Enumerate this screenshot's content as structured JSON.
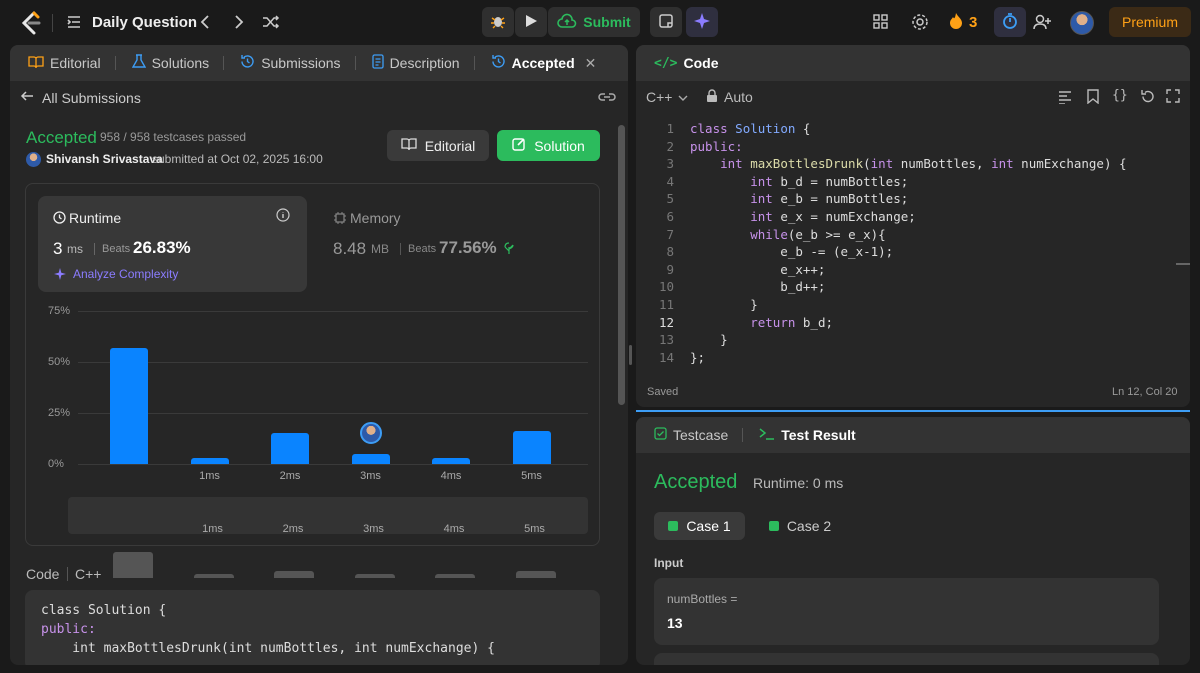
{
  "topbar": {
    "title": "Daily Question",
    "submit": "Submit",
    "streak": "3",
    "premium": "Premium"
  },
  "left_tabs": [
    "Editorial",
    "Solutions",
    "Submissions",
    "Description",
    "Accepted"
  ],
  "all_submissions": "All Submissions",
  "result": {
    "status": "Accepted",
    "passed": "958 / 958 testcases passed",
    "user": "Shivansh Srivastava",
    "submitted": "submitted at Oct 02, 2025 16:00",
    "editorial_btn": "Editorial",
    "solution_btn": "Solution"
  },
  "runtime": {
    "label": "Runtime",
    "value": "3",
    "unit": "ms",
    "beats_label": "Beats",
    "beats": "26.83%",
    "analyze": "Analyze Complexity"
  },
  "memory": {
    "label": "Memory",
    "value": "8.48",
    "unit": "MB",
    "beats_label": "Beats",
    "beats": "77.56%"
  },
  "chart_data": {
    "type": "bar",
    "categories": [
      "",
      "1ms",
      "2ms",
      "3ms",
      "4ms",
      "5ms"
    ],
    "values": [
      57,
      3,
      15,
      5,
      3,
      16
    ],
    "yticks": [
      "75%",
      "50%",
      "25%",
      "0%"
    ],
    "ylim": [
      0,
      75
    ],
    "highlight": "3ms",
    "minimap_labels": [
      "1ms",
      "2ms",
      "3ms",
      "4ms",
      "5ms"
    ]
  },
  "code_section": {
    "label": "Code",
    "lang": "C++",
    "lines": [
      "class Solution {",
      "public:",
      "    int maxBottlesDrunk(int numBottles, int numExchange) {"
    ]
  },
  "editor": {
    "title": "Code",
    "lang": "C++",
    "mode": "Auto",
    "saved": "Saved",
    "cursor": "Ln 12, Col 20",
    "lines": [
      "class Solution {",
      "public:",
      "    int maxBottlesDrunk(int numBottles, int numExchange) {",
      "        int b_d = numBottles;",
      "        int e_b = numBottles;",
      "        int e_x = numExchange;",
      "        while(e_b >= e_x){",
      "            e_b -= (e_x-1);",
      "            e_x++;",
      "            b_d++;",
      "        }",
      "        return b_d;",
      "    }",
      "};"
    ]
  },
  "testpanel": {
    "tab1": "Testcase",
    "tab2": "Test Result",
    "status": "Accepted",
    "runtime": "Runtime: 0 ms",
    "case1": "Case 1",
    "case2": "Case 2",
    "input_label": "Input",
    "var_name": "numBottles =",
    "var_value": "13"
  },
  "colors": {
    "accent": "#2cbb5d",
    "bar": "#0a84ff",
    "orange": "#ffa116"
  }
}
